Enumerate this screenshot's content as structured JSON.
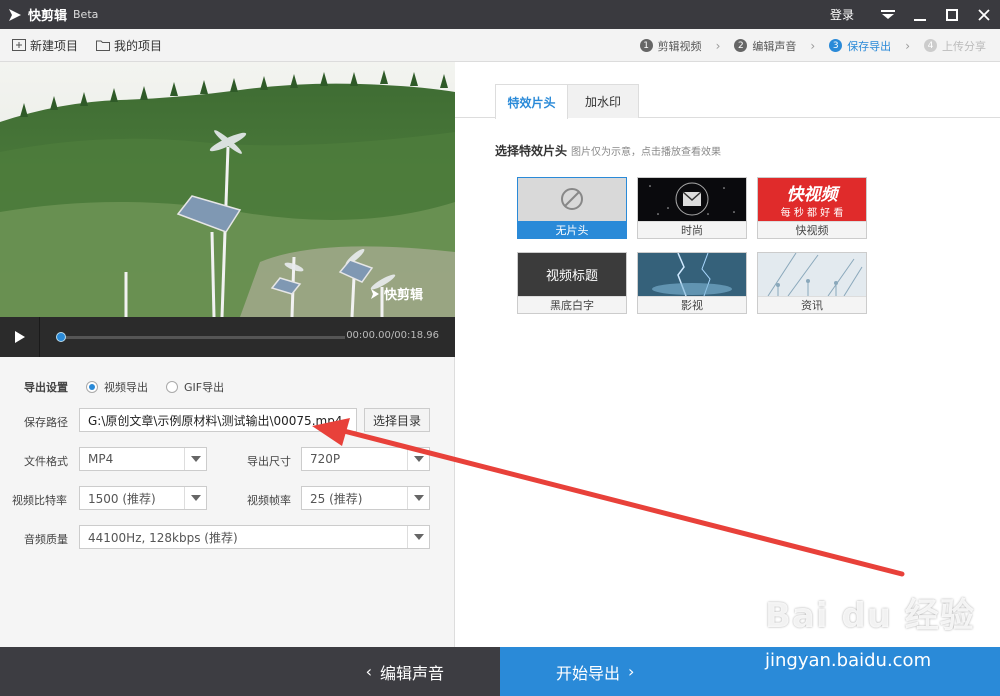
{
  "window": {
    "title": "快剪辑",
    "badge": "Beta",
    "login": "登录"
  },
  "toolbar": {
    "new_project": "新建项目",
    "my_projects": "我的项目",
    "steps": [
      {
        "num": "1",
        "label": "剪辑视频",
        "state": "done"
      },
      {
        "num": "2",
        "label": "编辑声音",
        "state": "done"
      },
      {
        "num": "3",
        "label": "保存导出",
        "state": "active"
      },
      {
        "num": "4",
        "label": "上传分享",
        "state": "disabled"
      }
    ]
  },
  "video": {
    "watermark": "快剪辑",
    "time": "00:00.00/00:18.96",
    "progress": 0.0
  },
  "export": {
    "heading": "导出设置",
    "mode_video": "视频导出",
    "mode_gif": "GIF导出",
    "selected_mode": "video",
    "path_label": "保存路径",
    "path_value": "G:\\原创文章\\示例原材料\\测试输出\\00075.mp4",
    "choose_dir": "选择目录",
    "format_label": "文件格式",
    "format_value": "MP4",
    "size_label": "导出尺寸",
    "size_value": "720P",
    "bitrate_label": "视频比特率",
    "bitrate_value": "1500 (推荐)",
    "framerate_label": "视频帧率",
    "framerate_value": "25 (推荐)",
    "audio_label": "音频质量",
    "audio_value": "44100Hz, 128kbps (推荐)"
  },
  "effects": {
    "tabs": [
      "特效片头",
      "加水印"
    ],
    "active_tab": 0,
    "section_title": "选择特效片头",
    "section_hint": "图片仅为示意，点击播放查看效果",
    "cards": [
      {
        "label": "无片头",
        "selected": true
      },
      {
        "label": "时尚",
        "selected": false
      },
      {
        "label": "快视频",
        "selected": false,
        "thumb_text": "快视频",
        "thumb_sub": "每 秒 都 好 看"
      },
      {
        "label": "黑底白字",
        "selected": false,
        "thumb_text": "视频标题"
      },
      {
        "label": "影视",
        "selected": false
      },
      {
        "label": "资讯",
        "selected": false
      }
    ]
  },
  "bottom": {
    "back": "编辑声音",
    "start": "开始导出"
  },
  "watermark": {
    "logo": "Bai du 经验",
    "url": "jingyan.baidu.com"
  },
  "colors": {
    "accent": "#2a8ad8",
    "titlebar": "#3a3a3f",
    "annotation": "#e8413a"
  }
}
